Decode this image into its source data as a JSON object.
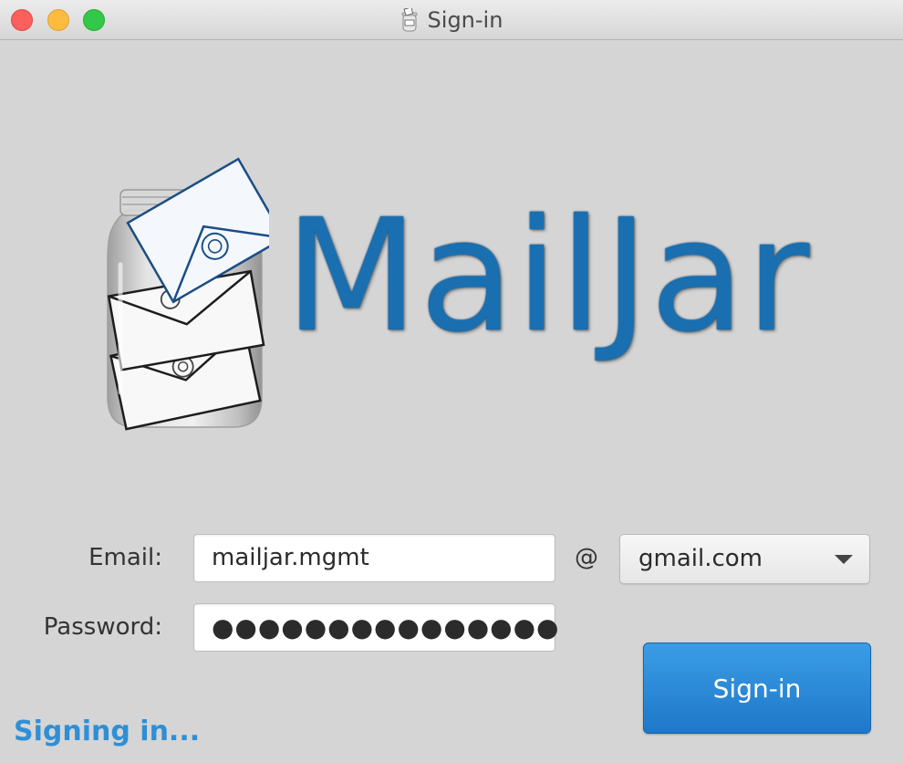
{
  "window": {
    "title": "Sign-in",
    "icon": "mail-jar-icon"
  },
  "logo": {
    "text": "MailJar",
    "icon": "mail-jar-icon",
    "color": "#1a6fb0"
  },
  "form": {
    "email_label": "Email:",
    "email_value": "mailjar.mgmt",
    "at_sign": "@",
    "domain_selected": "gmail.com",
    "password_label": "Password:",
    "password_masked": "●●●●●●●●●●●●●●●",
    "submit_label": "Sign-in"
  },
  "status": {
    "text": "Signing in...",
    "color": "#2f8fd6"
  },
  "colors": {
    "button": "#2a8ad8",
    "background": "#d5d5d5"
  }
}
